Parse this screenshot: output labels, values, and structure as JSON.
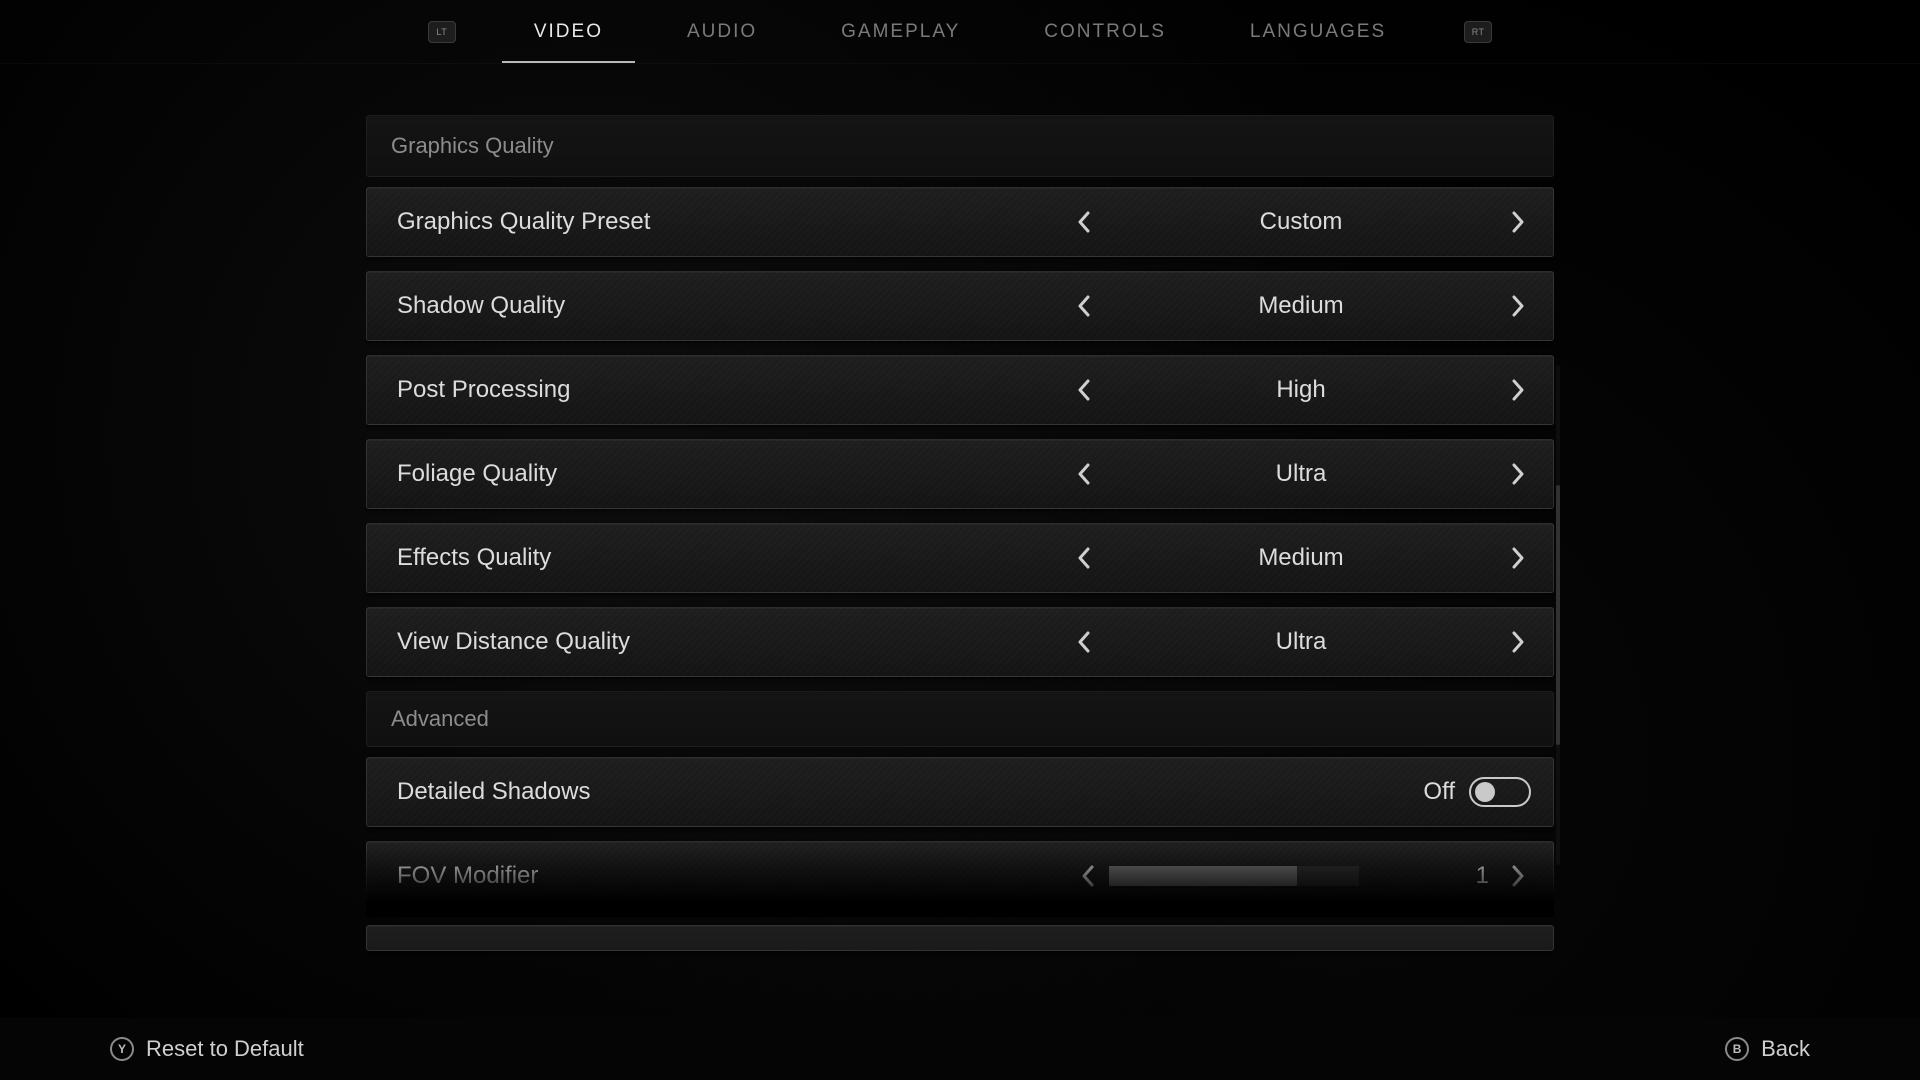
{
  "tabs": {
    "lt": "LT",
    "rt": "RT",
    "items": [
      "VIDEO",
      "AUDIO",
      "GAMEPLAY",
      "CONTROLS",
      "LANGUAGES"
    ],
    "active_index": 0
  },
  "sections": {
    "graphics_header": "Graphics Quality",
    "advanced_header": "Advanced"
  },
  "options": {
    "preset": {
      "label": "Graphics Quality Preset",
      "value": "Custom"
    },
    "shadow": {
      "label": "Shadow Quality",
      "value": "Medium"
    },
    "post": {
      "label": "Post Processing",
      "value": "High"
    },
    "foliage": {
      "label": "Foliage Quality",
      "value": "Ultra"
    },
    "effects": {
      "label": "Effects Quality",
      "value": "Medium"
    },
    "viewdist": {
      "label": "View Distance Quality",
      "value": "Ultra"
    },
    "detailed_shadows": {
      "label": "Detailed Shadows",
      "state_label": "Off",
      "on": false
    },
    "fov": {
      "label": "FOV Modifier",
      "value": "1",
      "fill_pct": 75
    }
  },
  "footer": {
    "reset_glyph": "Y",
    "reset_label": "Reset to Default",
    "back_glyph": "B",
    "back_label": "Back"
  }
}
